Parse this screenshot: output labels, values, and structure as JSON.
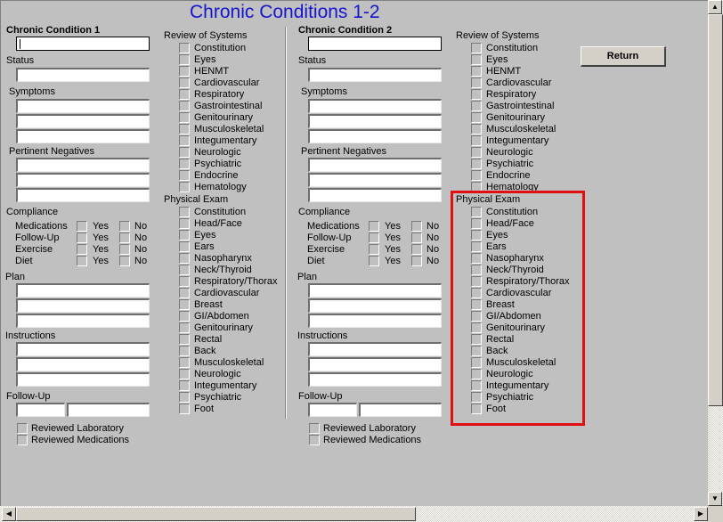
{
  "page": {
    "title": "Chronic Conditions 1-2",
    "return_label": "Return"
  },
  "conditions": [
    {
      "heading": "Chronic Condition 1",
      "condition_value": "",
      "status_label": "Status",
      "status_value": "",
      "symptoms_label": "Symptoms",
      "pertinent_negatives_label": "Pertinent Negatives",
      "compliance_label": "Compliance",
      "compliance_rows": [
        "Medications",
        "Follow-Up",
        "Exercise",
        "Diet"
      ],
      "yes_label": "Yes",
      "no_label": "No",
      "plan_label": "Plan",
      "instructions_label": "Instructions",
      "follow_up_label": "Follow-Up",
      "reviewed_laboratory_label": "Reviewed Laboratory",
      "reviewed_medications_label": "Reviewed Medications",
      "review_of_systems_label": "Review of Systems",
      "review_of_systems": [
        "Constitution",
        "Eyes",
        "HENMT",
        "Cardiovascular",
        "Respiratory",
        "Gastrointestinal",
        "Genitourinary",
        "Musculoskeletal",
        "Integumentary",
        "Neurologic",
        "Psychiatric",
        "Endocrine",
        "Hematology"
      ],
      "physical_exam_label": "Physical Exam",
      "physical_exam": [
        "Constitution",
        "Head/Face",
        "Eyes",
        "Ears",
        "Nasopharynx",
        "Neck/Thyroid",
        "Respiratory/Thorax",
        "Cardiovascular",
        "Breast",
        "GI/Abdomen",
        "Genitourinary",
        "Rectal",
        "Back",
        "Musculoskeletal",
        "Neurologic",
        "Integumentary",
        "Psychiatric",
        "Foot"
      ]
    },
    {
      "heading": "Chronic Condition 2",
      "condition_value": "",
      "status_label": "Status",
      "status_value": "",
      "symptoms_label": "Symptoms",
      "pertinent_negatives_label": "Pertinent Negatives",
      "compliance_label": "Compliance",
      "compliance_rows": [
        "Medications",
        "Follow-Up",
        "Exercise",
        "Diet"
      ],
      "yes_label": "Yes",
      "no_label": "No",
      "plan_label": "Plan",
      "instructions_label": "Instructions",
      "follow_up_label": "Follow-Up",
      "reviewed_laboratory_label": "Reviewed Laboratory",
      "reviewed_medications_label": "Reviewed Medications",
      "review_of_systems_label": "Review of Systems",
      "review_of_systems": [
        "Constitution",
        "Eyes",
        "HENMT",
        "Cardiovascular",
        "Respiratory",
        "Gastrointestinal",
        "Genitourinary",
        "Musculoskeletal",
        "Integumentary",
        "Neurologic",
        "Psychiatric",
        "Endocrine",
        "Hematology"
      ],
      "physical_exam_label": "Physical Exam",
      "physical_exam": [
        "Constitution",
        "Head/Face",
        "Eyes",
        "Ears",
        "Nasopharynx",
        "Neck/Thyroid",
        "Respiratory/Thorax",
        "Cardiovascular",
        "Breast",
        "GI/Abdomen",
        "Genitourinary",
        "Rectal",
        "Back",
        "Musculoskeletal",
        "Neurologic",
        "Integumentary",
        "Psychiatric",
        "Foot"
      ]
    }
  ],
  "annotation": {
    "highlight_color": "#e01010",
    "highlight_target": "Chronic Condition 2 Physical Exam"
  },
  "colors": {
    "title": "#1515d0",
    "background": "#c0c0c0",
    "button_face": "#d4d0c8"
  }
}
